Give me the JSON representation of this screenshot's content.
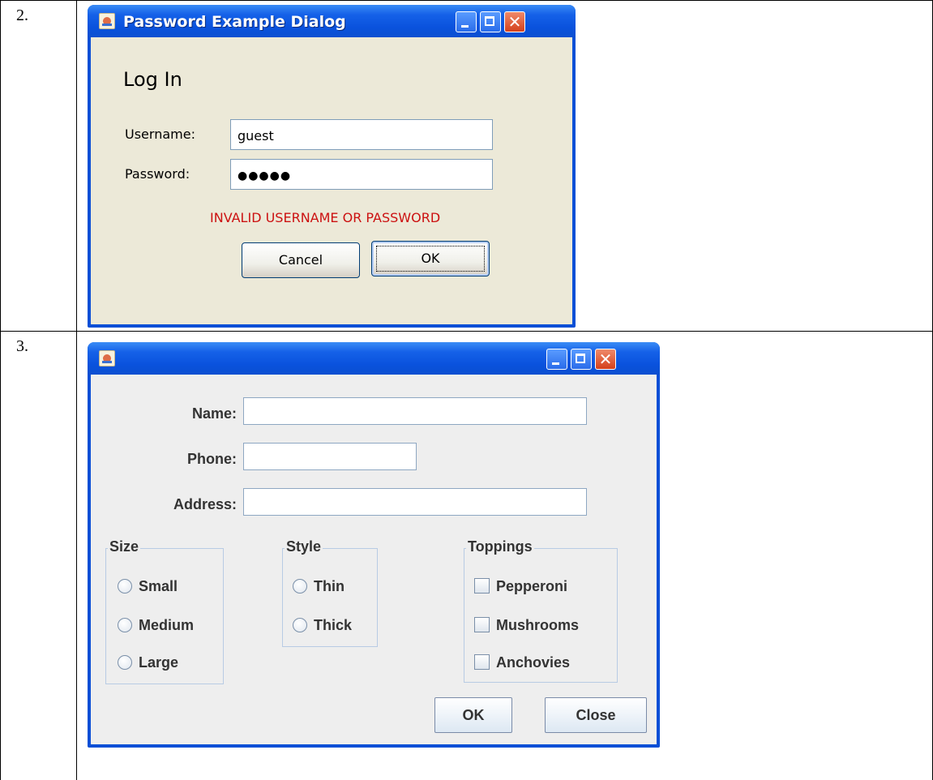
{
  "rows": [
    {
      "number": "2."
    },
    {
      "number": "3."
    }
  ],
  "dialog1": {
    "title": "Password Example Dialog",
    "heading": "Log In",
    "username_label": "Username:",
    "username_value": "guest",
    "password_label": "Password:",
    "password_mask": "●●●●●",
    "error": "INVALID USERNAME OR PASSWORD",
    "cancel_label": "Cancel",
    "ok_label": "OK",
    "icons": [
      "java-app-icon",
      "minimize-icon",
      "maximize-icon",
      "close-icon"
    ]
  },
  "dialog2": {
    "title": "",
    "name_label": "Name:",
    "phone_label": "Phone:",
    "address_label": "Address:",
    "size": {
      "title": "Size",
      "options": [
        "Small",
        "Medium",
        "Large"
      ]
    },
    "style": {
      "title": "Style",
      "options": [
        "Thin",
        "Thick"
      ]
    },
    "toppings": {
      "title": "Toppings",
      "options": [
        "Pepperoni",
        "Mushrooms",
        "Anchovies"
      ]
    },
    "ok_label": "OK",
    "close_label": "Close",
    "icons": [
      "java-app-icon",
      "minimize-icon",
      "maximize-icon",
      "close-icon"
    ]
  },
  "colors": {
    "xp_title_blue": "#0a52dd",
    "error_red": "#cc1111",
    "dialog1_bg": "#ece9d8",
    "dialog2_bg": "#eeeeee"
  }
}
